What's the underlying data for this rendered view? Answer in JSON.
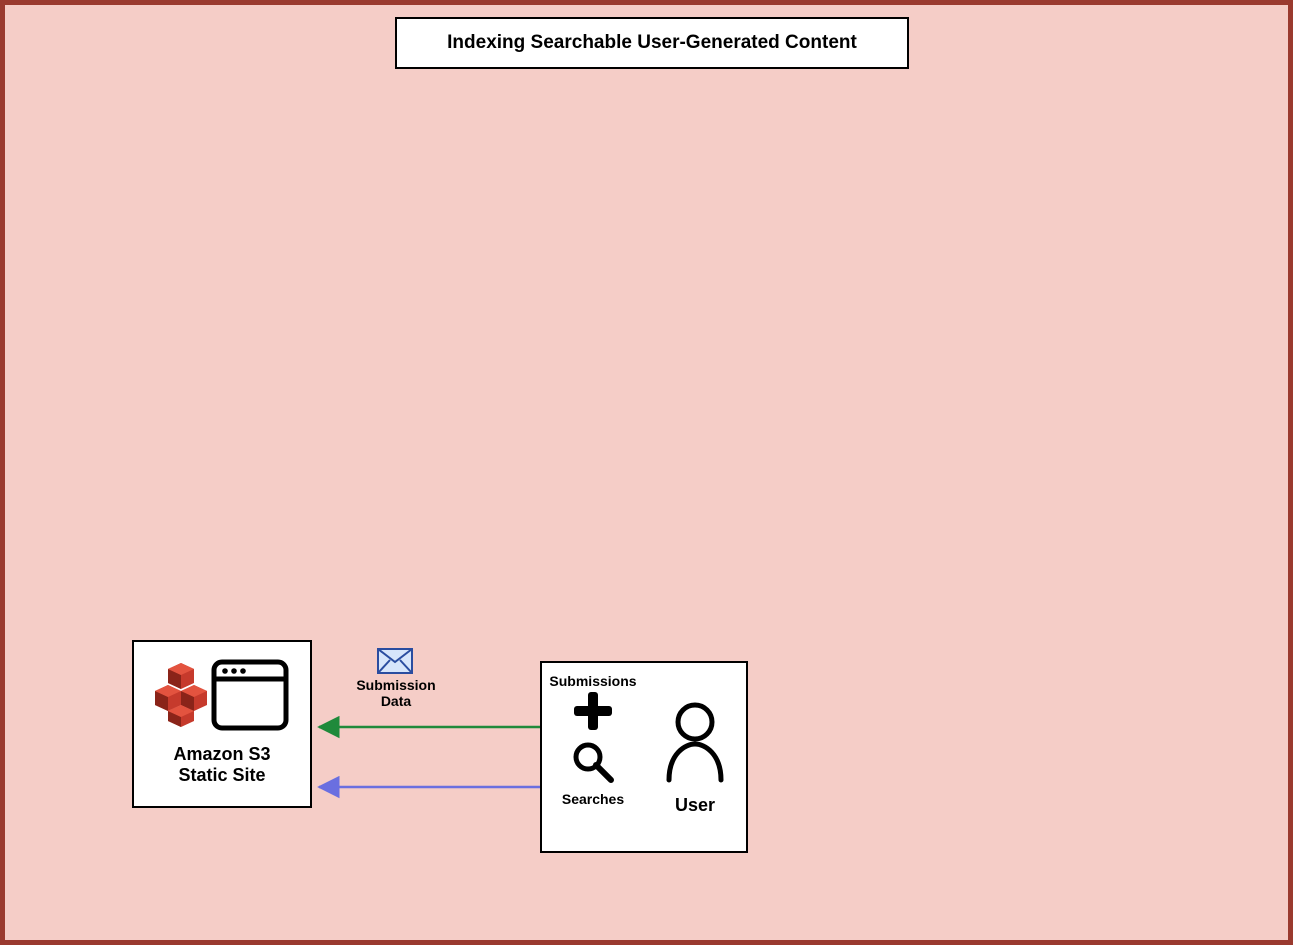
{
  "diagram": {
    "title": "Indexing Searchable User-Generated Content",
    "nodes": {
      "s3": {
        "label_line1": "Amazon S3",
        "label_line2": "Static Site"
      },
      "user": {
        "label": "User",
        "actions": {
          "submissions": "Submissions",
          "searches": "Searches"
        }
      }
    },
    "edges": {
      "submission": {
        "label_line1": "Submission",
        "label_line2": "Data",
        "color": "#1f8a3b"
      },
      "search": {
        "color": "#6a6fe0"
      }
    },
    "colors": {
      "canvas_bg": "#f5cdc7",
      "canvas_border": "#9a3a2f"
    }
  }
}
